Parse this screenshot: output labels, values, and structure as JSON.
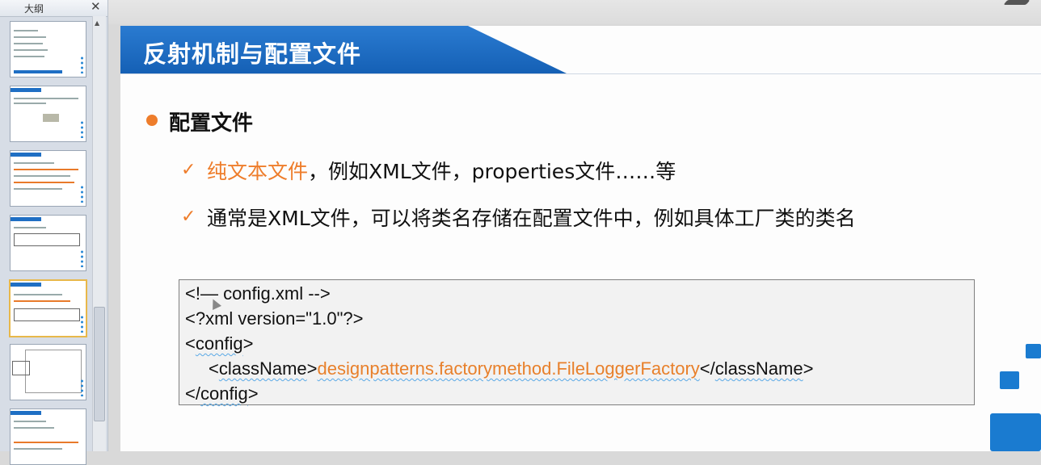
{
  "outline_panel": {
    "title": "大纲",
    "close_icon": "close-icon",
    "thumbnail_count": 7,
    "active_thumbnail_index": 4
  },
  "slide": {
    "title": "反射机制与配置文件",
    "bullet": "配置文件",
    "items": [
      {
        "check": "✓",
        "highlight": "纯文本文件",
        "rest": "，例如XML文件，properties文件……等"
      },
      {
        "check": "✓",
        "highlight": "",
        "rest": "通常是XML文件，可以将类名存储在配置文件中，例如具体工厂类的类名"
      }
    ],
    "code": {
      "line1": "<!— config.xml -->",
      "line2": "<?xml version=\"1.0\"?>",
      "line3_open": "<",
      "line3_tag": "config",
      "line3_close": ">",
      "line4_indent": "   ",
      "line4_open": "<",
      "line4_tag": "className",
      "line4_gt": ">",
      "line4_value": "designpatterns.factorymethod.FileLoggerFactory",
      "line4_end_open": "</",
      "line4_end_tag": "className",
      "line4_end_close": ">",
      "line5_open": "</",
      "line5_tag": "config",
      "line5_close": ">"
    }
  },
  "colors": {
    "title_blue": "#1f6fc4",
    "accent_orange": "#ee7d2b"
  }
}
